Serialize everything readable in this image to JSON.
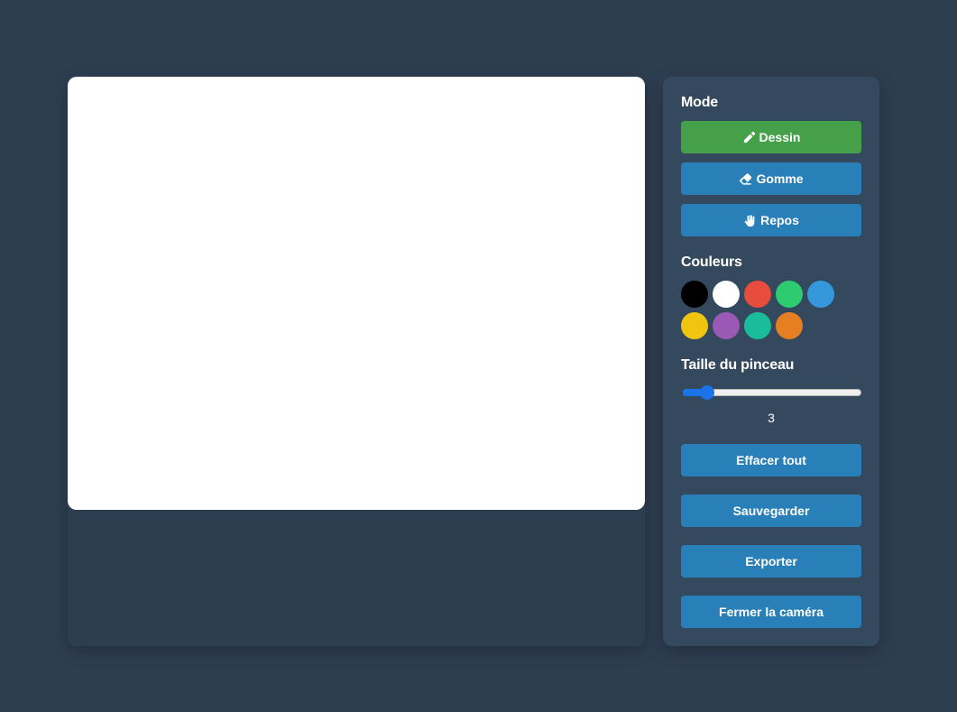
{
  "panel": {
    "mode_title": "Mode",
    "modes": [
      {
        "label": "Dessin",
        "icon": "pencil-icon",
        "active": true
      },
      {
        "label": "Gomme",
        "icon": "eraser-icon",
        "active": false
      },
      {
        "label": "Repos",
        "icon": "hand-icon",
        "active": false
      }
    ],
    "colors_title": "Couleurs",
    "colors": [
      "#000000",
      "#ffffff",
      "#e74c3c",
      "#2ecc71",
      "#3498db",
      "#f1c40f",
      "#9b59b6",
      "#1abc9c",
      "#e67e22"
    ],
    "brush_title": "Taille du pinceau",
    "brush_size": {
      "value": "3",
      "min": 1,
      "max": 20
    },
    "actions": {
      "clear": "Effacer tout",
      "save": "Sauvegarder",
      "export": "Exporter",
      "close_camera": "Fermer la caméra"
    }
  },
  "theme": {
    "background": "#2e3e51",
    "panel": "#34495e",
    "button": "#2980b9",
    "active_button": "#46a049",
    "slider_accent": "#1a73e8"
  }
}
